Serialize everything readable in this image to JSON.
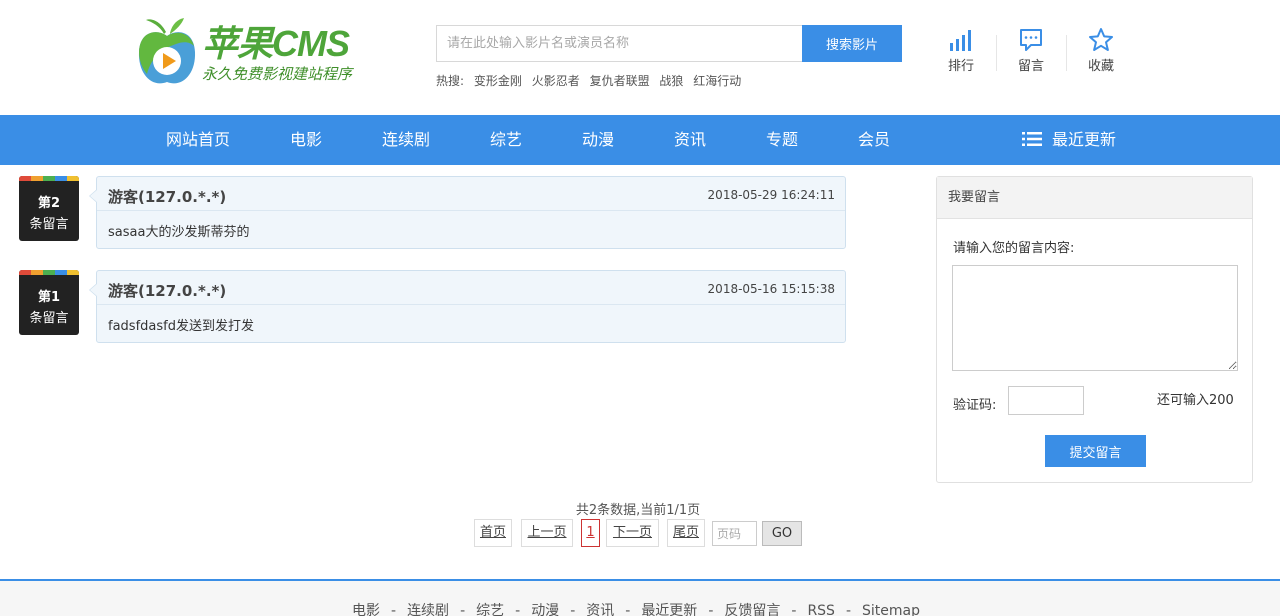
{
  "header": {
    "logo_title": "苹果CMS",
    "logo_subtitle": "永久免费影视建站程序",
    "search_placeholder": "请在此处输入影片名或演员名称",
    "search_button": "搜索影片",
    "hot_label": "热搜:",
    "hot_keywords": [
      "变形金刚",
      "火影忍者",
      "复仇者联盟",
      "战狼",
      "红海行动"
    ],
    "quick_links": [
      {
        "label": "排行",
        "icon": "bar-chart-icon"
      },
      {
        "label": "留言",
        "icon": "message-icon"
      },
      {
        "label": "收藏",
        "icon": "star-icon"
      }
    ]
  },
  "nav": {
    "items": [
      "网站首页",
      "电影",
      "连续剧",
      "综艺",
      "动漫",
      "资讯",
      "专题",
      "会员"
    ],
    "latest": "最近更新"
  },
  "messages": [
    {
      "num": "第2",
      "sub": "条留言",
      "author": "游客(127.0.*.*)",
      "time": "2018-05-29 16:24:11",
      "content": "sasaa大的沙发斯蒂芬的"
    },
    {
      "num": "第1",
      "sub": "条留言",
      "author": "游客(127.0.*.*)",
      "time": "2018-05-16 15:15:38",
      "content": "fadsfdasfd发送到发打发"
    }
  ],
  "side": {
    "title": "我要留言",
    "content_label": "请输入您的留言内容:",
    "vcode_label": "验证码:",
    "remain": "还可输入200",
    "submit": "提交留言"
  },
  "pagination": {
    "info": "共2条数据,当前1/1页",
    "first": "首页",
    "prev": "上一页",
    "current": "1",
    "next": "下一页",
    "last": "尾页",
    "page_placeholder": "页码",
    "go": "GO"
  },
  "footer": {
    "links": [
      "电影",
      "连续剧",
      "综艺",
      "动漫",
      "资讯",
      "最近更新",
      "反馈留言",
      "RSS",
      "Sitemap"
    ]
  },
  "colors": {
    "accent": "#3a8ee6",
    "logo_green": "#4ea53a",
    "badge_bg": "#222222",
    "bubble_bg": "#f0f6fb"
  }
}
